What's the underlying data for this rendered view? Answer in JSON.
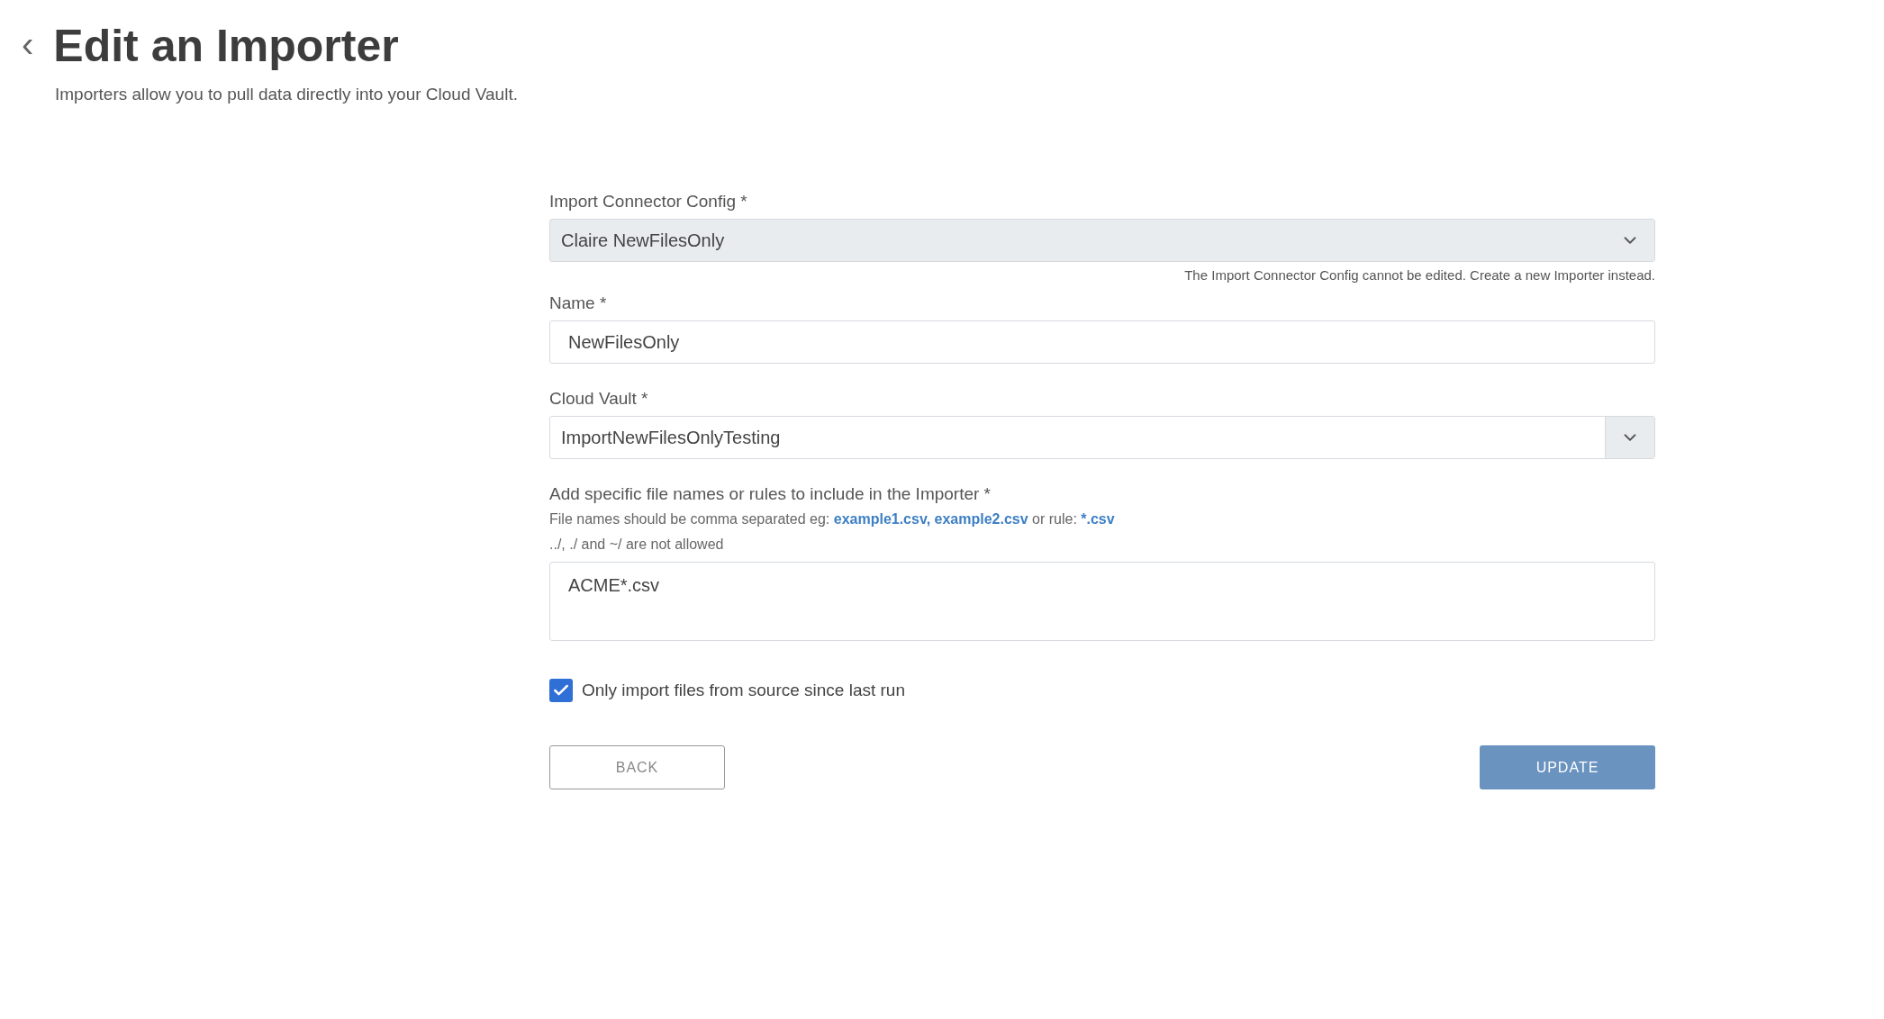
{
  "header": {
    "back_icon": "‹",
    "title": "Edit an Importer",
    "subtitle": "Importers allow you to pull data directly into your Cloud Vault."
  },
  "fields": [
    {
      "kind": "select",
      "label": "Import Connector Config *",
      "value": "Claire NewFilesOnly",
      "disabled": true,
      "note": "The Import Connector Config cannot be edited. Create a new Importer instead."
    },
    {
      "kind": "text",
      "label": "Name *",
      "value": "NewFilesOnly",
      "disabled": false
    },
    {
      "kind": "select",
      "label": "Cloud Vault *",
      "value": "ImportNewFilesOnlyTesting",
      "disabled": false
    },
    {
      "kind": "textarea",
      "label": "Add specific file names or rules to include in the Importer *",
      "hint": {
        "text": "File names should be comma separated eg:",
        "examples": "example1.csv, example2.csv",
        "middle": "or rule:",
        "rule": "*.csv"
      },
      "warning": "../, ./ and ~/ are not allowed",
      "value": "ACME*.csv",
      "disabled": false
    }
  ],
  "checkbox": {
    "label": "Only import files from source since last run",
    "checked": true
  },
  "buttons": {
    "back": "BACK",
    "update": "UPDATE"
  }
}
